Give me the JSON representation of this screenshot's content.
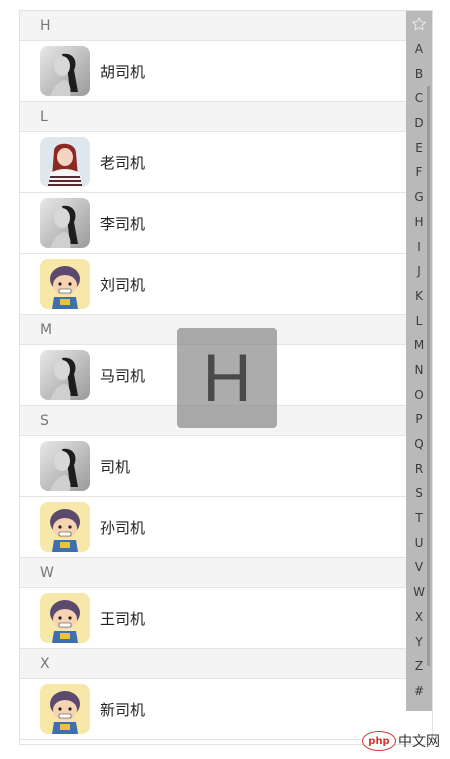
{
  "sections": [
    {
      "letter": "H",
      "contacts": [
        {
          "name": "胡司机",
          "avatar": "girl-bw"
        }
      ]
    },
    {
      "letter": "L",
      "contacts": [
        {
          "name": "老司机",
          "avatar": "girl-color"
        },
        {
          "name": "李司机",
          "avatar": "girl-bw"
        },
        {
          "name": "刘司机",
          "avatar": "cartoon-boy"
        }
      ]
    },
    {
      "letter": "M",
      "contacts": [
        {
          "name": "马司机",
          "avatar": "girl-bw"
        }
      ]
    },
    {
      "letter": "S",
      "contacts": [
        {
          "name": "司机",
          "avatar": "girl-bw"
        },
        {
          "name": "孙司机",
          "avatar": "cartoon-boy"
        }
      ]
    },
    {
      "letter": "W",
      "contacts": [
        {
          "name": "王司机",
          "avatar": "cartoon-boy"
        }
      ]
    },
    {
      "letter": "X",
      "contacts": [
        {
          "name": "新司机",
          "avatar": "cartoon-boy"
        }
      ]
    }
  ],
  "index_bar": {
    "top_icon": "star-outline-icon",
    "letters": [
      "A",
      "B",
      "C",
      "D",
      "E",
      "F",
      "G",
      "H",
      "I",
      "J",
      "K",
      "L",
      "M",
      "N",
      "O",
      "P",
      "Q",
      "R",
      "S",
      "T",
      "U",
      "V",
      "W",
      "X",
      "Y",
      "Z",
      "#"
    ]
  },
  "overlay_letter": "H",
  "watermark": {
    "logo": "php",
    "text": "中文网"
  },
  "colors": {
    "header_bg": "#f4f4f4",
    "index_bar_bg": "#b9b9b9",
    "overlay_bg": "#808080",
    "watermark_red": "#d6352f"
  }
}
